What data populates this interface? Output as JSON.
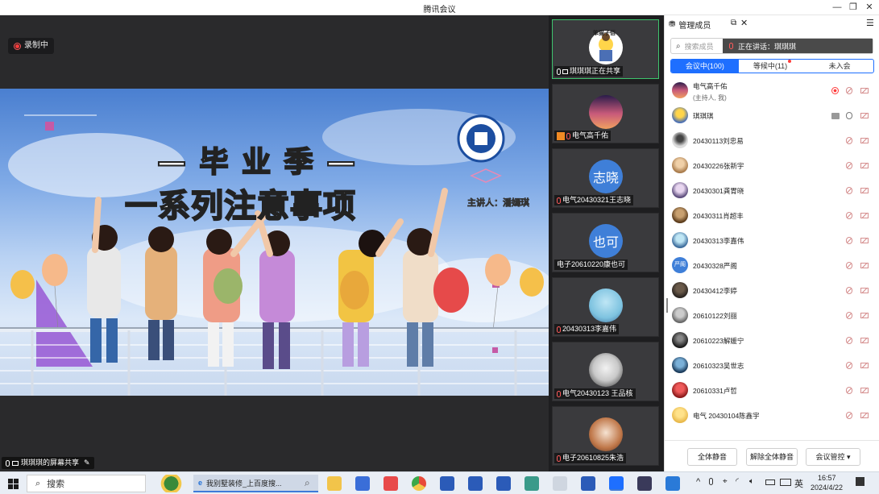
{
  "window": {
    "title": "腾讯会议"
  },
  "stage": {
    "recording_label": "录制中",
    "share_label": "琪琪琪的屏幕共享",
    "slide": {
      "title_line1": "— 毕 业 季 —",
      "title_line2": "一系列注意事项",
      "presenter": "主讲人：潘嫣琪"
    }
  },
  "thumbnails": [
    {
      "label": "琪琪琪正在共享",
      "avatar_caption": "笨猫子佰"
    },
    {
      "label": "电气高千佑"
    },
    {
      "label": "电气20430321王志晓",
      "avatar_text": "志晓"
    },
    {
      "label": "电子20610220康也可",
      "avatar_text": "也可"
    },
    {
      "label": "20430313李嘉伟"
    },
    {
      "label": "电气20430123 王品核"
    },
    {
      "label": "电子20610825朱浩"
    }
  ],
  "panel": {
    "title": "管理成员",
    "search_placeholder": "搜索成员",
    "speaking": "正在讲话：琪琪琪",
    "tabs": [
      {
        "label": "会议中(100)"
      },
      {
        "label": "等候中(11)"
      },
      {
        "label": "未入会"
      }
    ],
    "members": [
      {
        "name": "电气高千佑",
        "sub": "(主持人, 我)"
      },
      {
        "name": "琪琪琪"
      },
      {
        "name": "20430113刘忠易"
      },
      {
        "name": "20430226张新宇"
      },
      {
        "name": "20430301龚胃晓"
      },
      {
        "name": "20430311肖超丰"
      },
      {
        "name": "20430313李嘉伟"
      },
      {
        "name": "20430328严阁"
      },
      {
        "name": "20430412李婷"
      },
      {
        "name": "20610122刘丽"
      },
      {
        "name": "20610223解媛宁"
      },
      {
        "name": "20610323吴世志"
      },
      {
        "name": "20610331卢哲"
      },
      {
        "name": "电气 20430104陈鑫宇"
      }
    ],
    "footer": {
      "mute_all": "全体静音",
      "unmute_all": "解除全体静音",
      "meeting_control": "会议管控 ▾"
    }
  },
  "taskbar": {
    "search_label": "搜索",
    "browser_tab": "我别墅装修_上百度搜...",
    "time": "16:57",
    "date": "2024/4/22",
    "ime": "英"
  }
}
